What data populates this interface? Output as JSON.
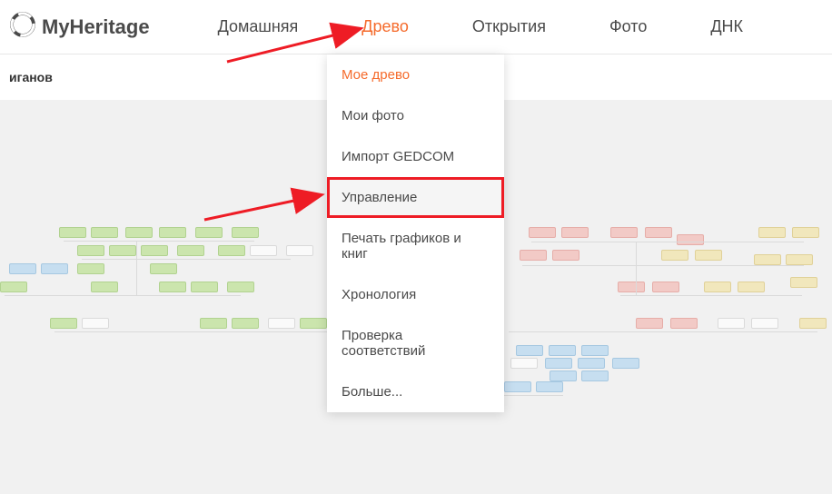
{
  "brand": "MyHeritage",
  "nav": {
    "home": "Домашняя",
    "tree": "Древо",
    "discoveries": "Открытия",
    "photo": "Фото",
    "dna": "ДНК"
  },
  "page_label": "иганов",
  "dropdown": {
    "my_tree": "Мое древо",
    "my_photos": "Мои фото",
    "import_gedcom": "Импорт GEDCOM",
    "manage": "Управление",
    "print": "Печать графиков и книг",
    "timeline": "Хронология",
    "consistency": "Проверка соответствий",
    "more": "Больше..."
  }
}
